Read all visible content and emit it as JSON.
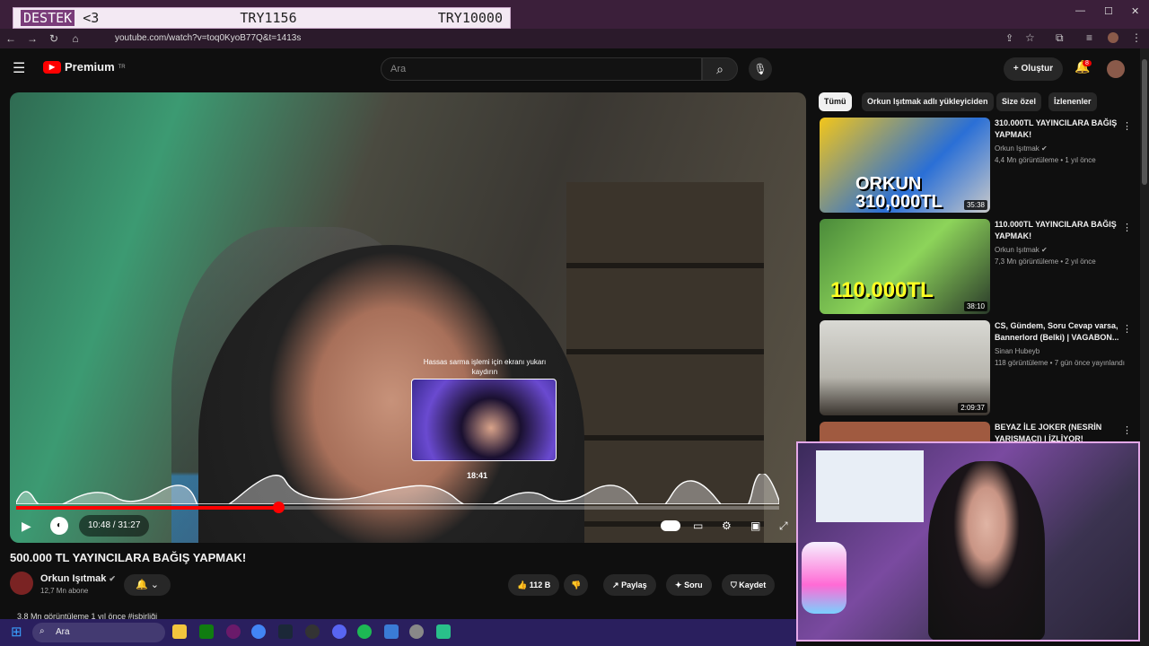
{
  "overlay": {
    "lead": "DESTEK",
    "heart": "<3",
    "middle": "TRY1156",
    "right": "TRY10000"
  },
  "browser": {
    "url": "youtube.com/watch?v=toq0KyoB77Q&t=1413s"
  },
  "header": {
    "logo": "Premium",
    "logo_sup": "TR",
    "search_placeholder": "Ara",
    "create_label": "Oluştur",
    "notification_count": "8"
  },
  "player": {
    "seek_hint": "Hassas sarma işlemi için ekranı yukarı kaydırın",
    "preview_time": "18:41",
    "time": "10:48 / 31:27",
    "progress": 0.344
  },
  "video": {
    "title": "500.000 TL YAYINCILARA BAĞIŞ YAPMAK!",
    "channel": "Orkun Işıtmak",
    "subscribers": "12,7 Mn abone",
    "likes": "112 B",
    "share": "Paylaş",
    "ask": "Soru",
    "save": "Kaydet",
    "views_line": "3,8 Mn görüntüleme  1 yıl önce  #işbirliği"
  },
  "sidebar": {
    "chips": [
      "Tümü",
      "Orkun Işıtmak adlı yükleyiciden",
      "Size özel",
      "İzlenenler"
    ],
    "items": [
      {
        "title": "310.000TL YAYINCILARA BAĞIŞ YAPMAK!",
        "channel": "Orkun Işıtmak",
        "meta": "4,4 Mn görüntüleme • 1 yıl önce",
        "duration": "35:38",
        "thumb_text": "ORKUN 310,000TL"
      },
      {
        "title": "110.000TL YAYINCILARA BAĞIŞ YAPMAK!",
        "channel": "Orkun Işıtmak",
        "meta": "7,3 Mn görüntüleme • 2 yıl önce",
        "duration": "38:10",
        "thumb_text": "110.000TL"
      },
      {
        "title": "CS, Gündem, Soru Cevap varsa, Bannerlord (Belki) | VAGABON...",
        "channel": "Sinan Hubeyb",
        "meta": "118 görüntüleme • 7 gün önce yayınlandı",
        "duration": "2:09:37",
        "thumb_text": ""
      },
      {
        "title": "BEYAZ İLE JOKER (NESRİN YARIŞMACI) | İZLİYOR!",
        "channel": "",
        "meta": "",
        "duration": "",
        "thumb_text": ""
      }
    ]
  },
  "taskbar": {
    "search": "Ara"
  }
}
